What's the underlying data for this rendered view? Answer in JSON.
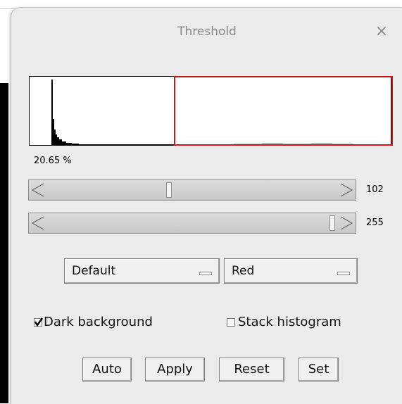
{
  "dialog": {
    "title": "Threshold",
    "close_glyph": "×"
  },
  "histogram": {
    "percent_label": "20.65 %",
    "selection_color": "#c81818"
  },
  "sliders": {
    "lower": {
      "value": "102",
      "min": 0,
      "max": 255
    },
    "upper": {
      "value": "255",
      "min": 0,
      "max": 255
    }
  },
  "selects": {
    "method": "Default",
    "display": "Red"
  },
  "options": {
    "dark_background": {
      "label": "Dark background",
      "checked": true
    },
    "stack_histogram": {
      "label": "Stack histogram",
      "checked": false
    }
  },
  "buttons": {
    "auto": "Auto",
    "apply": "Apply",
    "reset": "Reset",
    "set": "Set"
  }
}
